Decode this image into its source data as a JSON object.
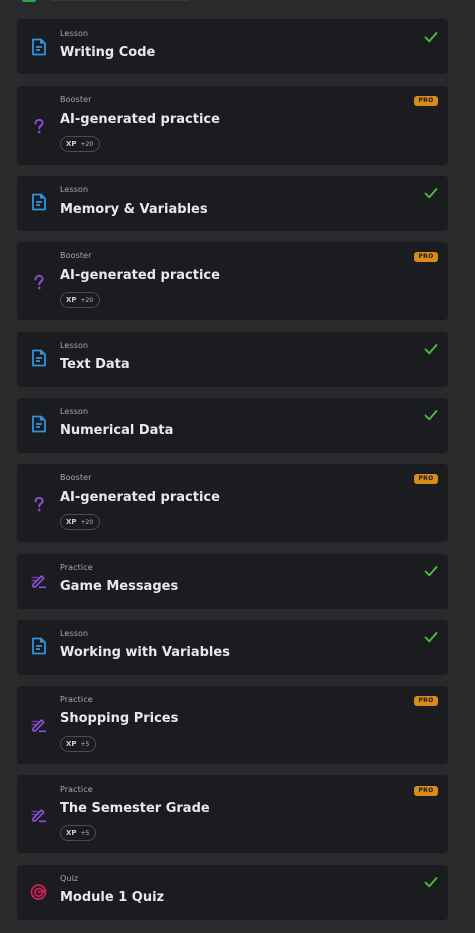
{
  "colors": {
    "lesson_icon": "#2f95e0",
    "booster_icon": "#8a4fd6",
    "practice_icon": "#8a4fd6",
    "quiz_icon": "#d81f5a",
    "check": "#4cc23a",
    "pro_badge": "#d98b18"
  },
  "items": [
    {
      "kind": "Lesson",
      "title": "Writing Code",
      "icon": "lesson-document-icon",
      "status": "completed"
    },
    {
      "kind": "Booster",
      "title": "AI-generated practice",
      "icon": "question-mark-icon",
      "badge": "PRO",
      "xp_label": "XP",
      "xp_value": "+20"
    },
    {
      "kind": "Lesson",
      "title": "Memory & Variables",
      "icon": "lesson-document-icon",
      "status": "completed"
    },
    {
      "kind": "Booster",
      "title": "AI-generated practice",
      "icon": "question-mark-icon",
      "badge": "PRO",
      "xp_label": "XP",
      "xp_value": "+20"
    },
    {
      "kind": "Lesson",
      "title": "Text Data",
      "icon": "lesson-document-icon",
      "status": "completed"
    },
    {
      "kind": "Lesson",
      "title": "Numerical Data",
      "icon": "lesson-document-icon",
      "status": "completed"
    },
    {
      "kind": "Booster",
      "title": "AI-generated practice",
      "icon": "question-mark-icon",
      "badge": "PRO",
      "xp_label": "XP",
      "xp_value": "+20"
    },
    {
      "kind": "Practice",
      "title": "Game Messages",
      "icon": "pencil-edit-icon",
      "status": "completed"
    },
    {
      "kind": "Lesson",
      "title": "Working with Variables",
      "icon": "lesson-document-icon",
      "status": "completed"
    },
    {
      "kind": "Practice",
      "title": "Shopping Prices",
      "icon": "pencil-edit-icon",
      "badge": "PRO",
      "xp_label": "XP",
      "xp_value": "+5"
    },
    {
      "kind": "Practice",
      "title": "The Semester Grade",
      "icon": "pencil-edit-icon",
      "badge": "PRO",
      "xp_label": "XP",
      "xp_value": "+5"
    },
    {
      "kind": "Quiz",
      "title": "Module 1 Quiz",
      "icon": "target-icon",
      "status": "completed"
    }
  ]
}
